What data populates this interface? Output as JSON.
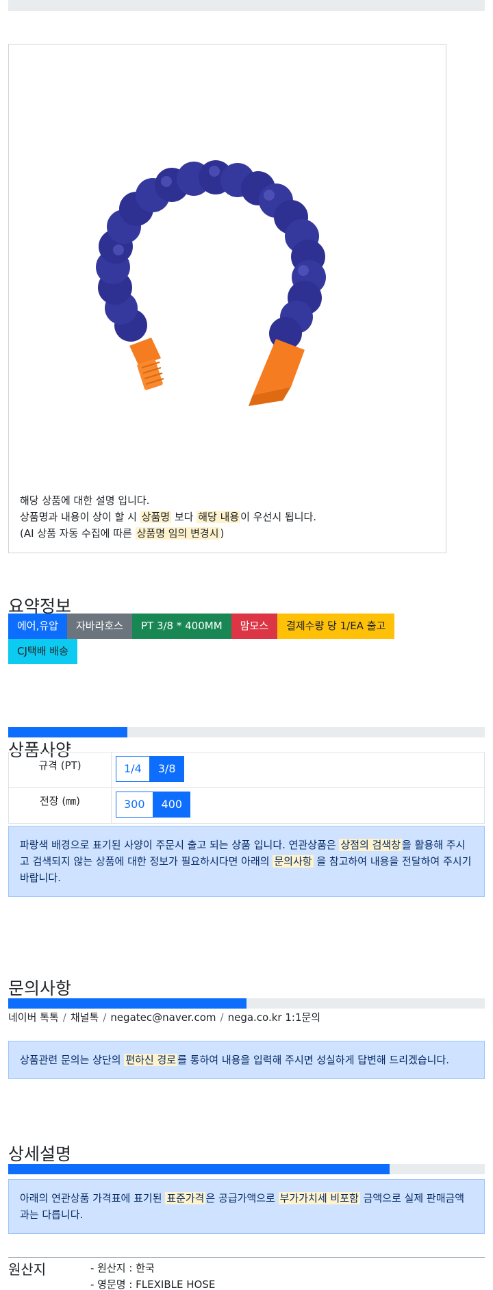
{
  "description": {
    "line1": "해당 상품에 대한 설명 입니다.",
    "line2_a": "상품명과 내용이 상이 할 시 ",
    "line2_hl1": "상품명",
    "line2_b": " 보다 ",
    "line2_hl2": "해당 내용",
    "line2_c": "이 우선시 됩니다.",
    "line3_a": "(AI 상품 자동 수집에 따른 ",
    "line3_hl": "상품명 임의 변경시",
    "line3_b": ")"
  },
  "summary": {
    "title": "요약정보",
    "badges": [
      "에어,유압",
      "자바라호스",
      "PT 3/8 * 400MM",
      "맘모스",
      "결제수량 당 1/EA 출고",
      "CJ택배 배송"
    ]
  },
  "spec": {
    "progress": 0.25,
    "title": "상품사양",
    "rows": [
      {
        "label": "규격 (PT)",
        "options": [
          "1/4",
          "3/8"
        ],
        "selected": "3/8"
      },
      {
        "label": "전장 (㎜)",
        "options": [
          "300",
          "400"
        ],
        "selected": "400"
      }
    ],
    "notice_a": "파랑색 배경으로 표기된 사양이 주문시 출고 되는 상품 입니다. 연관상품은 ",
    "notice_hl1": "상점의 검색창",
    "notice_b": "을 활용해 주시고 검색되지 않는 상품에 대한 정보가 필요하시다면 아래의 ",
    "notice_hl2": "문의사항",
    "notice_c": " 을 참고하여 내용을 전달하여 주시기 바랍니다."
  },
  "inquiry": {
    "title": "문의사항",
    "progress": 0.5,
    "contacts": [
      "네이버 톡톡",
      "채널톡",
      "negatec@naver.com",
      "nega.co.kr 1:1문의"
    ],
    "notice_a": "상품관련 문의는 상단의 ",
    "notice_hl": "편하신 경로",
    "notice_b": "를 통하여 내용을 입력해 주시면 성실하게 답변해 드리겠습니다."
  },
  "detail": {
    "title": "상세설명",
    "progress": 0.8,
    "notice_a": "아래의 연관상품 가격표에 표기된 ",
    "notice_hl1": "표준가격",
    "notice_b": "은 공급가액으로 ",
    "notice_hl2": "부가가치세 비포함",
    "notice_c": " 금액으로 실제 판매금액과는 다릅니다."
  },
  "origin": {
    "label": "원산지",
    "lines": [
      "- 원산지 : 한국",
      "- 영문명 : FLEXIBLE HOSE"
    ]
  },
  "colors": {
    "primary": "#0d6efd",
    "hose_blue": "#2e3192",
    "nozzle_orange": "#f57c20",
    "highlight": "#fff3cd",
    "alert_bg": "#cfe2ff"
  }
}
